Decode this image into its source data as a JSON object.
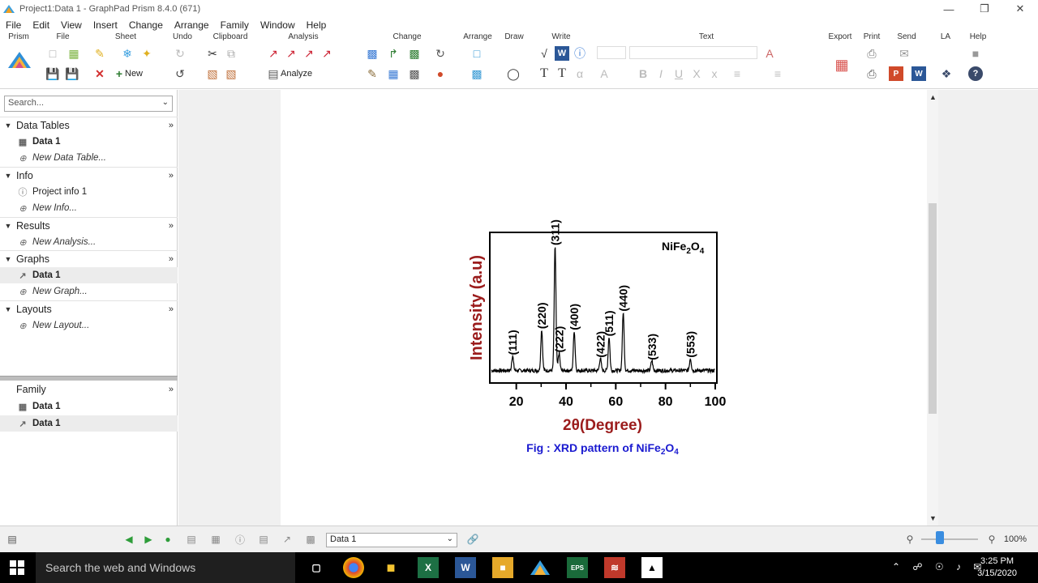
{
  "window": {
    "title": "Project1:Data 1 - GraphPad Prism 8.4.0 (671)",
    "controls": [
      "minimize-icon",
      "restore-icon",
      "close-icon"
    ]
  },
  "menu": [
    "File",
    "Edit",
    "View",
    "Insert",
    "Change",
    "Arrange",
    "Family",
    "Window",
    "Help"
  ],
  "ribbon": {
    "groups": [
      "Prism",
      "File",
      "Sheet",
      "Undo",
      "Clipboard",
      "Analysis",
      "Change",
      "Arrange",
      "Draw",
      "Write",
      "Text",
      "Export",
      "Print",
      "Send",
      "LA",
      "Help"
    ],
    "new_label": "New",
    "analyze_label": "Analyze"
  },
  "sidebar": {
    "search_placeholder": "Search...",
    "sections": [
      {
        "name": "Data Tables",
        "items": [
          {
            "label": "Data 1",
            "kind": "table"
          },
          {
            "label": "New Data Table...",
            "kind": "new"
          }
        ]
      },
      {
        "name": "Info",
        "items": [
          {
            "label": "Project info 1",
            "kind": "info"
          },
          {
            "label": "New Info...",
            "kind": "new"
          }
        ]
      },
      {
        "name": "Results",
        "items": [
          {
            "label": "New Analysis...",
            "kind": "new"
          }
        ]
      },
      {
        "name": "Graphs",
        "items": [
          {
            "label": "Data 1",
            "kind": "graph"
          },
          {
            "label": "New Graph...",
            "kind": "new"
          }
        ]
      },
      {
        "name": "Layouts",
        "items": [
          {
            "label": "New Layout...",
            "kind": "new"
          }
        ]
      }
    ],
    "family": {
      "name": "Family",
      "items": [
        {
          "label": "Data 1",
          "kind": "table"
        },
        {
          "label": "Data 1",
          "kind": "graph"
        }
      ]
    }
  },
  "graph": {
    "compound_label": "NiFe",
    "compound_sub1": "2",
    "compound_o": "O",
    "compound_sub2": "4",
    "ylabel": "Intensity (a.u)",
    "xlabel": "2θ(Degree)",
    "xticks": [
      "20",
      "40",
      "60",
      "80",
      "100"
    ],
    "caption_prefix": "Fig : XRD pattern of NiFe",
    "caption_sub1": "2",
    "caption_o": "O",
    "caption_sub2": "4",
    "peak_labels": [
      "(111)",
      "(220)",
      "(311)",
      "(222)",
      "(400)",
      "(422)",
      "(511)",
      "(440)",
      "(533)",
      "(553)"
    ]
  },
  "chart_data": {
    "type": "line",
    "title": "",
    "xlabel": "2θ(Degree)",
    "ylabel": "Intensity (a.u)",
    "xlim": [
      10,
      100
    ],
    "ylim": [
      0,
      100
    ],
    "legend": "NiFe2O4",
    "grid": false,
    "peaks": [
      {
        "label": "(111)",
        "x": 18.5,
        "y": 12
      },
      {
        "label": "(220)",
        "x": 30.2,
        "y": 33
      },
      {
        "label": "(311)",
        "x": 35.6,
        "y": 100
      },
      {
        "label": "(222)",
        "x": 37.2,
        "y": 14
      },
      {
        "label": "(400)",
        "x": 43.3,
        "y": 32
      },
      {
        "label": "(422)",
        "x": 53.8,
        "y": 10
      },
      {
        "label": "(511)",
        "x": 57.3,
        "y": 27
      },
      {
        "label": "(440)",
        "x": 63.0,
        "y": 47
      },
      {
        "label": "(533)",
        "x": 74.5,
        "y": 8
      },
      {
        "label": "(553)",
        "x": 90.0,
        "y": 10
      }
    ]
  },
  "statusbar": {
    "sheet_value": "Data 1",
    "zoom": "100%"
  },
  "taskbar": {
    "search_placeholder": "Search the web and Windows",
    "time": "3:25 PM",
    "date": "3/15/2020"
  },
  "colors": {
    "ylabel": "#9b1c1c",
    "xlabel": "#9b1c1c",
    "caption": "#1a1ad0"
  }
}
